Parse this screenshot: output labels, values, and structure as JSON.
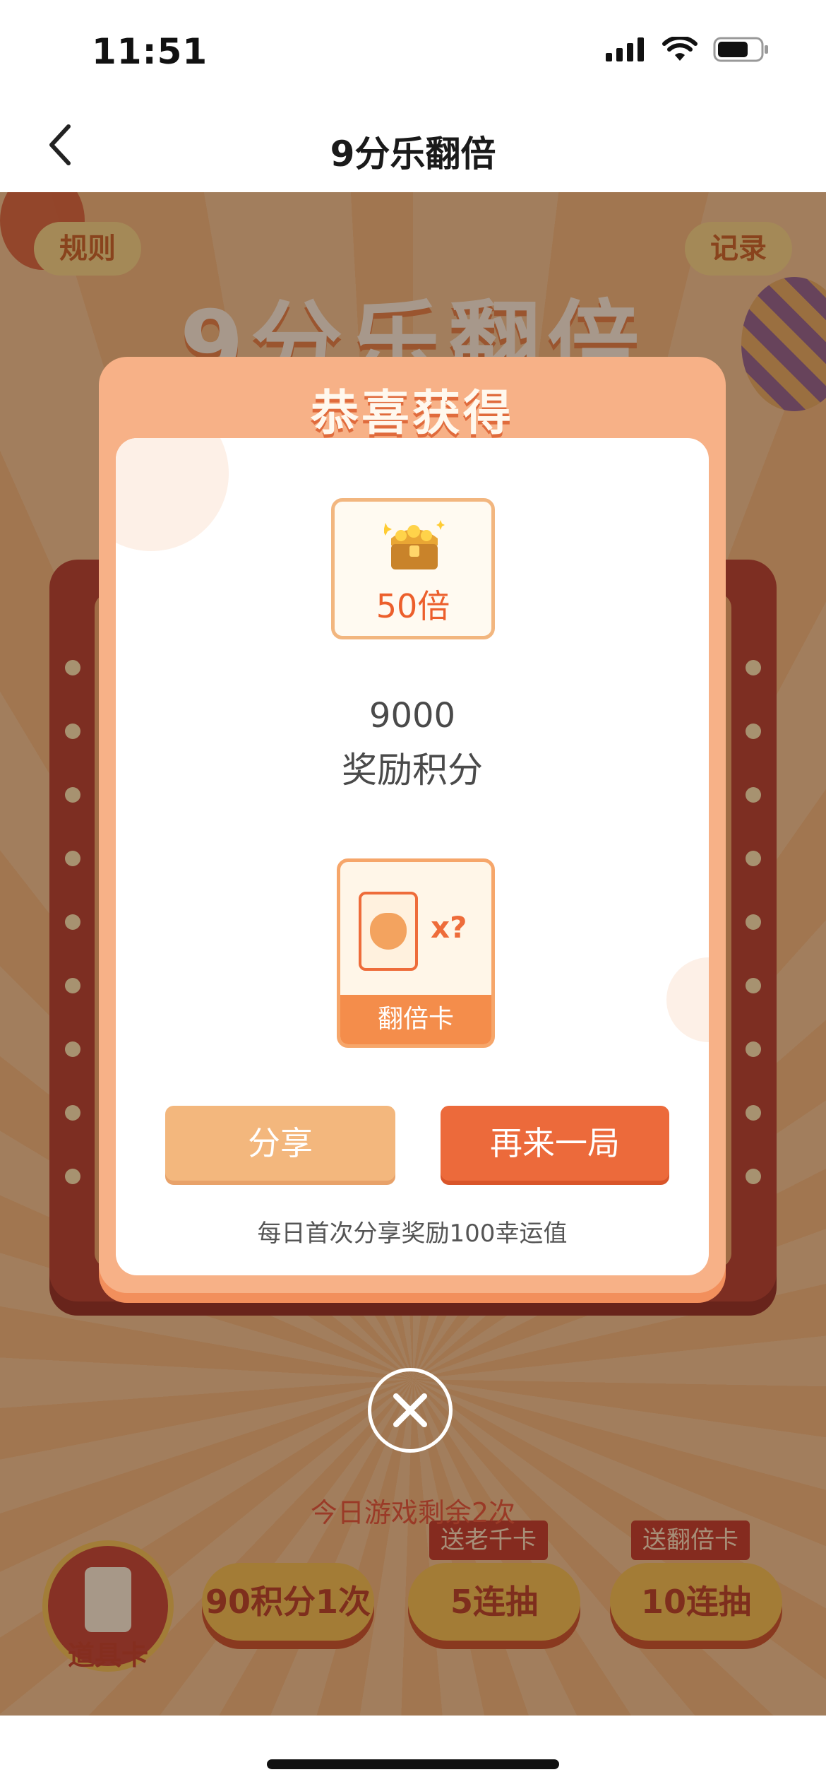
{
  "status_bar": {
    "time": "11:51",
    "icons": [
      "signal-icon",
      "wifi-icon",
      "battery-icon"
    ]
  },
  "nav": {
    "title": "9分乐翻倍",
    "back_icon": "chevron-left-icon"
  },
  "game": {
    "rules_label": "规则",
    "record_label": "记录",
    "title": "9分乐翻倍",
    "prop_card_label": "道具卡",
    "draw_buttons": [
      {
        "label": "90积分1次",
        "tag": ""
      },
      {
        "label": "5连抽",
        "tag": "送老千卡"
      },
      {
        "label": "10连抽",
        "tag": "送翻倍卡"
      }
    ],
    "remaining_text": "今日游戏剩余2次"
  },
  "modal": {
    "title": "恭喜获得",
    "reward": {
      "icon": "treasure-chest-icon",
      "multiplier": "50倍"
    },
    "points": {
      "value": "9000",
      "label": "奖励积分"
    },
    "card": {
      "icon": "cat-card-icon",
      "quantity": "x?",
      "label": "翻倍卡"
    },
    "buttons": {
      "share": "分享",
      "again": "再来一局"
    },
    "share_note": "每日首次分享奖励100幸运值",
    "close_icon": "close-icon"
  },
  "colors": {
    "accent": "#ec6a3b",
    "share_button": "#f3b77d",
    "modal_frame": "#f7b187",
    "board": "#b23326"
  }
}
